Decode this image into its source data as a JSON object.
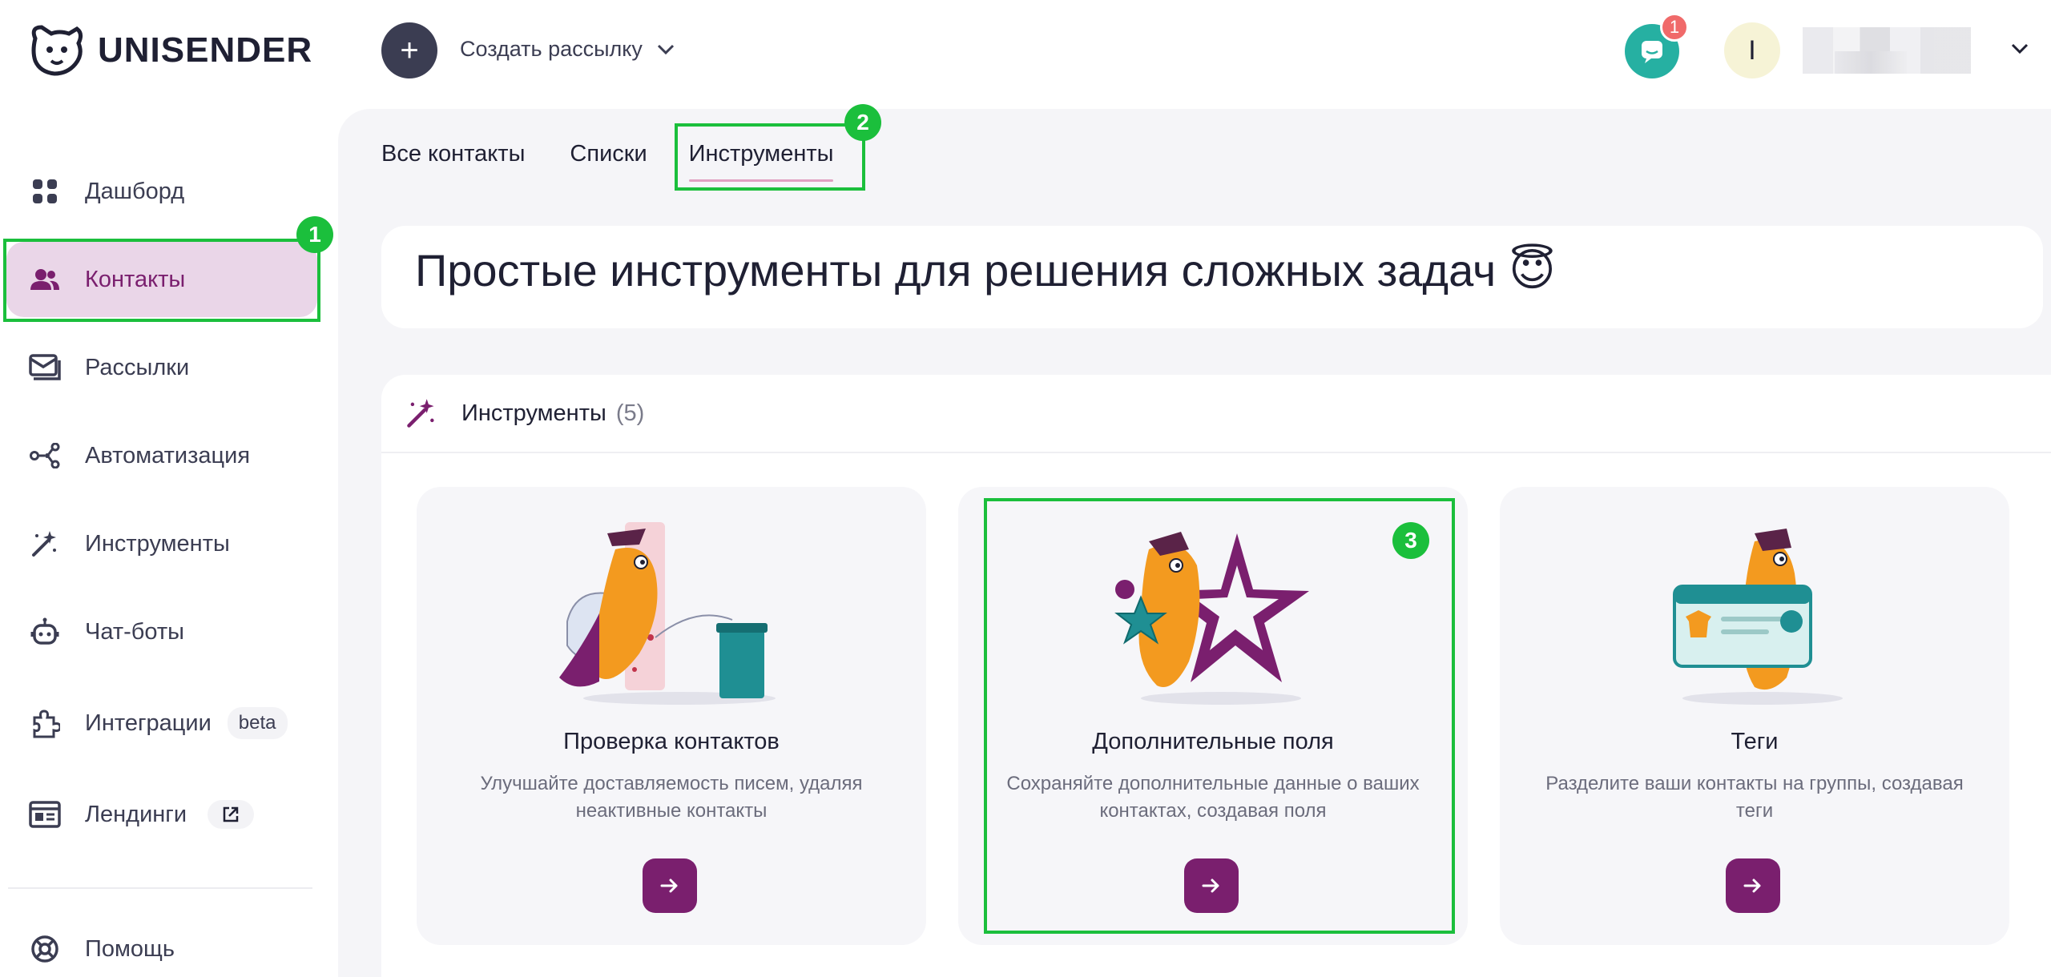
{
  "app": {
    "logo_text": "UNISENDER"
  },
  "topbar": {
    "create_label": "Создать рассылку",
    "create_plus": "+",
    "chat_badge": "1",
    "avatar_initial": "I"
  },
  "sidebar": {
    "items": [
      {
        "label": "Дашборд",
        "icon": "dashboard-icon"
      },
      {
        "label": "Контакты",
        "icon": "contacts-icon",
        "active": true
      },
      {
        "label": "Рассылки",
        "icon": "mail-icon"
      },
      {
        "label": "Автоматизация",
        "icon": "automation-icon"
      },
      {
        "label": "Инструменты",
        "icon": "magic-wand-icon"
      },
      {
        "label": "Чат-боты",
        "icon": "chatbot-icon"
      },
      {
        "label": "Интеграции",
        "icon": "puzzle-icon",
        "pill": "beta"
      },
      {
        "label": "Лендинги",
        "icon": "landing-icon",
        "external": true
      },
      {
        "label": "Помощь",
        "icon": "help-icon"
      }
    ]
  },
  "tabs": [
    {
      "label": "Все контакты"
    },
    {
      "label": "Списки"
    },
    {
      "label": "Инструменты",
      "active": true
    }
  ],
  "hero": {
    "title": "Простые инструменты для решения сложных задач",
    "emoji": "😇"
  },
  "tools_panel": {
    "title": "Инструменты",
    "count": "(5)",
    "cards": [
      {
        "title": "Проверка контактов",
        "desc": "Улучшайте доставляемость писем, удаляя неактивные контакты"
      },
      {
        "title": "Дополнительные поля",
        "desc": "Сохраняйте дополнительные данные о ваших контактах, создавая поля"
      },
      {
        "title": "Теги",
        "desc": "Разделите ваши контакты на группы, создавая теги"
      }
    ]
  },
  "annotations": {
    "one": "1",
    "two": "2",
    "three": "3"
  },
  "colors": {
    "brand": "#7a1f6e",
    "active_bg": "#ead6e8",
    "chat": "#26b0a2",
    "annotation": "#1bbf3c"
  }
}
